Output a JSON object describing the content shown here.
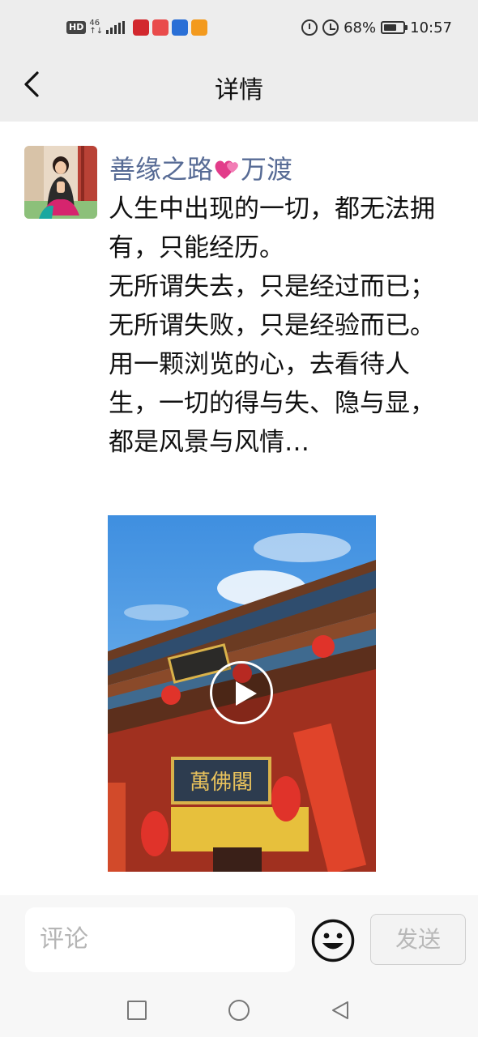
{
  "status_bar": {
    "hd": "HD",
    "network_top": "46",
    "network_bottom": "↑↓",
    "battery": "68%",
    "battery_level": 0.68,
    "time": "10:57"
  },
  "header": {
    "title": "详情"
  },
  "post": {
    "author": "善缘之路",
    "author_suffix": "万渡",
    "text": "人生中出现的一切，都无法拥有，只能经历。\n无所谓失去，只是经过而已；无所谓失败，只是经验而已。\n用一颗浏览的心，去看待人生，一切的得与失、隐与显，都是风景与风情…",
    "video_plaque": "萬佛閣"
  },
  "comment": {
    "placeholder": "评论",
    "send_label": "发送"
  },
  "icons": {
    "back": "chevron-left-icon",
    "heart": "two-hearts-icon",
    "play": "play-icon",
    "emoji": "smiley-face-icon",
    "nav_recent": "square-icon",
    "nav_home": "circle-icon",
    "nav_back": "triangle-back-icon"
  },
  "colors": {
    "author_link": "#576b95",
    "background": "#ededed"
  }
}
